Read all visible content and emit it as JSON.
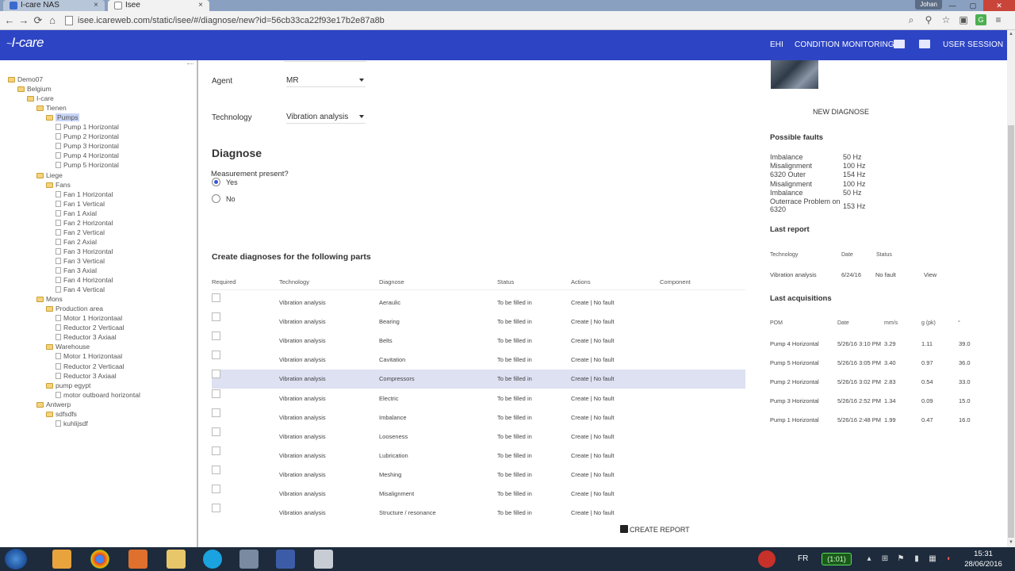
{
  "browser": {
    "tabs": [
      {
        "label": "I-care NAS"
      },
      {
        "label": "Isee"
      }
    ],
    "url": "isee.icareweb.com/static/isee/#/diagnose/new?id=56cb33ca22f93e17b2e87a8b",
    "user": "Johan",
    "back": "←",
    "forward": "→",
    "reload": "⟳",
    "home": "⌂",
    "close_x": "×",
    "win_min": "—",
    "win_max": "▢",
    "win_close": "✕",
    "tools": [
      "⌕",
      "⚲",
      "☆",
      "▣",
      "▦",
      "≡"
    ],
    "ext_label": "G"
  },
  "header": {
    "logo": "I-care",
    "logo_swirl": "~",
    "nav_ehi": "EHI",
    "nav_condition": "CONDITION MONITORING",
    "nav_session": "USER SESSION"
  },
  "tree": [
    {
      "label": "Demo07",
      "type": "folder",
      "level": 0
    },
    {
      "label": "Belgium",
      "type": "folder",
      "level": 1
    },
    {
      "label": "I-care",
      "type": "folder",
      "level": 2
    },
    {
      "label": "Tienen",
      "type": "folder",
      "level": 3
    },
    {
      "label": "Pumps",
      "type": "folder",
      "level": 4,
      "selected": true
    },
    {
      "label": "Pump 1 Horizontal",
      "type": "doc",
      "level": 5
    },
    {
      "label": "Pump 2 Horizontal",
      "type": "doc",
      "level": 5
    },
    {
      "label": "Pump 3 Horizontal",
      "type": "doc",
      "level": 5
    },
    {
      "label": "Pump 4 Horizontal",
      "type": "doc",
      "level": 5
    },
    {
      "label": "Pump 5 Horizontal",
      "type": "doc",
      "level": 5
    },
    {
      "label": "Liege",
      "type": "folder",
      "level": 3
    },
    {
      "label": "Fans",
      "type": "folder",
      "level": 4
    },
    {
      "label": "Fan 1 Horizontal",
      "type": "doc",
      "level": 5
    },
    {
      "label": "Fan 1 Vertical",
      "type": "doc",
      "level": 5
    },
    {
      "label": "Fan 1 Axial",
      "type": "doc",
      "level": 5
    },
    {
      "label": "Fan 2 Horizontal",
      "type": "doc",
      "level": 5
    },
    {
      "label": "Fan 2 Vertical",
      "type": "doc",
      "level": 5
    },
    {
      "label": "Fan 2 Axial",
      "type": "doc",
      "level": 5
    },
    {
      "label": "Fan 3 Horizontal",
      "type": "doc",
      "level": 5
    },
    {
      "label": "Fan 3 Vertical",
      "type": "doc",
      "level": 5
    },
    {
      "label": "Fan 3 Axial",
      "type": "doc",
      "level": 5
    },
    {
      "label": "Fan 4 Horizontal",
      "type": "doc",
      "level": 5
    },
    {
      "label": "Fan 4 Vertical",
      "type": "doc",
      "level": 5
    },
    {
      "label": "Mons",
      "type": "folder",
      "level": 3
    },
    {
      "label": "Production area",
      "type": "folder",
      "level": 4
    },
    {
      "label": "Motor 1 Horizontaal",
      "type": "doc",
      "level": 5
    },
    {
      "label": "Reductor 2 Verticaal",
      "type": "doc",
      "level": 5
    },
    {
      "label": "Reductor 3 Axiaal",
      "type": "doc",
      "level": 5
    },
    {
      "label": "Warehouse",
      "type": "folder",
      "level": 4
    },
    {
      "label": "Motor 1 Horizontaal",
      "type": "doc",
      "level": 5
    },
    {
      "label": "Reductor 2 Verticaal",
      "type": "doc",
      "level": 5
    },
    {
      "label": "Reductor 3 Axiaal",
      "type": "doc",
      "level": 5
    },
    {
      "label": "pump egypt",
      "type": "folder",
      "level": 4
    },
    {
      "label": "motor outboard horizontal",
      "type": "doc",
      "level": 5
    },
    {
      "label": "Antwerp",
      "type": "folder",
      "level": 3
    },
    {
      "label": "sdfsdfs",
      "type": "folder",
      "level": 4
    },
    {
      "label": "kuhlijsdf",
      "type": "doc",
      "level": 5
    }
  ],
  "form": {
    "agent_label": "Agent",
    "agent_value": "MR",
    "technology_label": "Technology",
    "technology_value": "Vibration analysis",
    "diagnose_title": "Diagnose",
    "measurement_label": "Measurement present?",
    "yes_label": "Yes",
    "no_label": "No",
    "measurement_selected": "Yes",
    "parts_title": "Create diagnoses for the following parts",
    "create_report": "CREATE REPORT"
  },
  "parts_table": {
    "headers": {
      "required": "Required",
      "technology": "Technology",
      "diagnose": "Diagnose",
      "status": "Status",
      "actions": "Actions",
      "component": "Component"
    },
    "rows": [
      {
        "technology": "Vibration analysis",
        "diagnose": "Aeraulic",
        "status": "To be filled in",
        "actions": "Create | No fault"
      },
      {
        "technology": "Vibration analysis",
        "diagnose": "Bearing",
        "status": "To be filled in",
        "actions": "Create | No fault"
      },
      {
        "technology": "Vibration analysis",
        "diagnose": "Belts",
        "status": "To be filled in",
        "actions": "Create | No fault"
      },
      {
        "technology": "Vibration analysis",
        "diagnose": "Cavitation",
        "status": "To be filled in",
        "actions": "Create | No fault"
      },
      {
        "technology": "Vibration analysis",
        "diagnose": "Compressors",
        "status": "To be filled in",
        "actions": "Create | No fault",
        "highlighted": true
      },
      {
        "technology": "Vibration analysis",
        "diagnose": "Electric",
        "status": "To be filled in",
        "actions": "Create | No fault"
      },
      {
        "technology": "Vibration analysis",
        "diagnose": "Imbalance",
        "status": "To be filled in",
        "actions": "Create | No fault"
      },
      {
        "technology": "Vibration analysis",
        "diagnose": "Looseness",
        "status": "To be filled in",
        "actions": "Create | No fault"
      },
      {
        "technology": "Vibration analysis",
        "diagnose": "Lubrication",
        "status": "To be filled in",
        "actions": "Create | No fault"
      },
      {
        "technology": "Vibration analysis",
        "diagnose": "Meshing",
        "status": "To be filled in",
        "actions": "Create | No fault"
      },
      {
        "technology": "Vibration analysis",
        "diagnose": "Misalignment",
        "status": "To be filled in",
        "actions": "Create | No fault"
      },
      {
        "technology": "Vibration analysis",
        "diagnose": "Structure / resonance",
        "status": "To be filled in",
        "actions": "Create | No fault"
      }
    ]
  },
  "right": {
    "new_diagnose": "NEW DIAGNOSE",
    "possible_faults_title": "Possible faults",
    "faults": [
      {
        "name": "Imbalance",
        "value": "50 Hz"
      },
      {
        "name": "Misalignment",
        "value": "100 Hz"
      },
      {
        "name": "6320 Outer",
        "value": "154 Hz"
      },
      {
        "name": "Misalignment",
        "value": "100 Hz"
      },
      {
        "name": "Imbalance",
        "value": "50 Hz"
      },
      {
        "name": "Outerrace Problem on 6320",
        "value": "153 Hz"
      }
    ],
    "last_report_title": "Last report",
    "last_report_headers": {
      "technology": "Technology",
      "date": "Date",
      "status": "Status"
    },
    "last_report_row": {
      "technology": "Vibration analysis",
      "date": "6/24/16",
      "status": "No fault",
      "action": "View"
    },
    "last_acq_title": "Last acquisitions",
    "acq_headers": {
      "pom": "POM",
      "date": "Date",
      "mms": "mm/s",
      "gpk": "g (pk)",
      "deg": "°"
    },
    "acquisitions": [
      {
        "pom": "Pump 4 Horizontal",
        "date": "5/26/16 3:10 PM",
        "mms": "3.29",
        "gpk": "1.11",
        "deg": "39.0"
      },
      {
        "pom": "Pump 5 Horizontal",
        "date": "5/26/16 3:05 PM",
        "mms": "3.40",
        "gpk": "0.97",
        "deg": "36.0"
      },
      {
        "pom": "Pump 2 Horizontal",
        "date": "5/26/16 3:02 PM",
        "mms": "2.83",
        "gpk": "0.54",
        "deg": "33.0"
      },
      {
        "pom": "Pump 3 Horizontal",
        "date": "5/26/16 2:52 PM",
        "mms": "1.34",
        "gpk": "0.09",
        "deg": "15.0"
      },
      {
        "pom": "Pump 1 Horizontal",
        "date": "5/26/16 2:48 PM",
        "mms": "1.99",
        "gpk": "0.47",
        "deg": "16.0"
      }
    ]
  },
  "taskbar": {
    "language": "FR",
    "battery": "(1:01)",
    "time": "15:31",
    "date": "28/06/2016",
    "scroll_up": "▲",
    "scroll_down": "▼"
  },
  "colors": {
    "header_bg": "#2d45c4",
    "highlight_row": "#dde1f2",
    "radio_accent": "#3a56d4"
  }
}
